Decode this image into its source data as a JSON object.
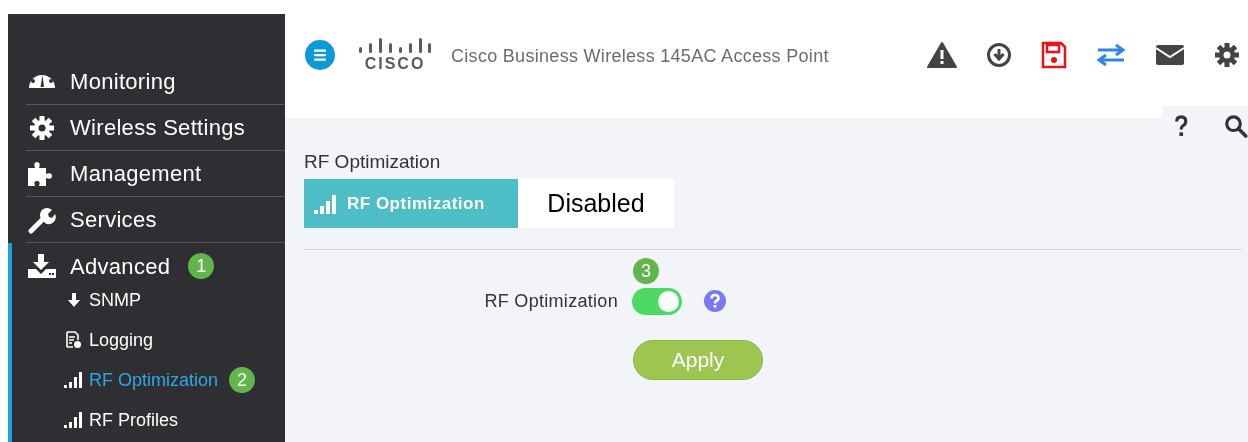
{
  "header": {
    "logo_text": "CISCO",
    "title": "Cisco Business Wireless 145AC Access Point"
  },
  "sidebar": {
    "items": [
      {
        "label": "Monitoring",
        "kind": "gauge",
        "expanded": false
      },
      {
        "label": "Wireless Settings",
        "kind": "gear",
        "expanded": false
      },
      {
        "label": "Management",
        "kind": "puzzle",
        "expanded": false
      },
      {
        "label": "Services",
        "kind": "wrench",
        "expanded": false
      },
      {
        "label": "Advanced",
        "kind": "tray",
        "expanded": true,
        "badge": "1",
        "children": [
          {
            "label": "SNMP",
            "kind": "arrow",
            "selected": false
          },
          {
            "label": "Logging",
            "kind": "doc",
            "selected": false
          },
          {
            "label": "RF Optimization",
            "kind": "signal",
            "selected": true,
            "badge": "2"
          },
          {
            "label": "RF Profiles",
            "kind": "signal",
            "selected": false
          }
        ]
      }
    ]
  },
  "page": {
    "title": "RF Optimization",
    "status_banner": {
      "label": "RF Optimization",
      "value": "Disabled"
    },
    "setting": {
      "label": "RF Optimization",
      "on": true,
      "badge": "3"
    },
    "apply_button": "Apply"
  }
}
